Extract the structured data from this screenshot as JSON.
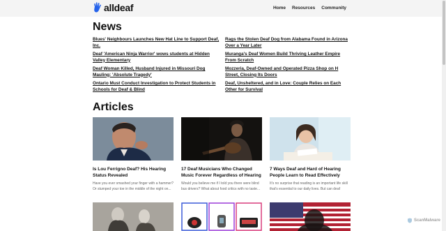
{
  "header": {
    "logo_text": "alldeaf",
    "nav": [
      "Home",
      "Resources",
      "Community"
    ]
  },
  "news": {
    "title": "News",
    "items": [
      "Blues' Neighbours Launches New Hat Line to Support Deaf, Inc.",
      "Rags the Stolen Deaf Dog from Alabama Found in Arizona Over a Year Later",
      "Deaf 'American Ninja Warrior' wows students at Hidden Valley Elementary",
      "Muranga's Deaf Women Build Thriving Leather Empire From Scratch",
      "Deaf Woman Killed, Husband Injured in Missouri Dog Mauling: 'Absolute Tragedy'",
      "Mozzeria, Deaf-Owned and Operated Pizza Shop on H Street, Closing Its Doors",
      "Ontario Must Conduct Investigation to Protect Students in Schools for Deaf & Blind",
      "Deaf, Unsheltered, and in Love: Couple Relies on Each Other for Survival"
    ]
  },
  "articles": {
    "title": "Articles",
    "cards": [
      {
        "title": "Is Lou Ferrigno Deaf? His Hearing Status Revealed",
        "excerpt": "Have you ever smashed your finger with a hammer? Or stumped your toe in the middle of the night on..."
      },
      {
        "title": "17 Deaf Musicians Who Changed Music Forever Regardless of Hearing Loss",
        "excerpt": "Would you believe me if I told you there were blind bus drivers? What about food critics with no taste..."
      },
      {
        "title": "7 Ways Deaf and Hard of Hearing People Learn to Read Effectively",
        "excerpt": "It's no surprise that reading is an important life skill that's essential to our daily lives. But can deaf people..."
      }
    ]
  },
  "watermark": {
    "text": "ScanMalware"
  }
}
